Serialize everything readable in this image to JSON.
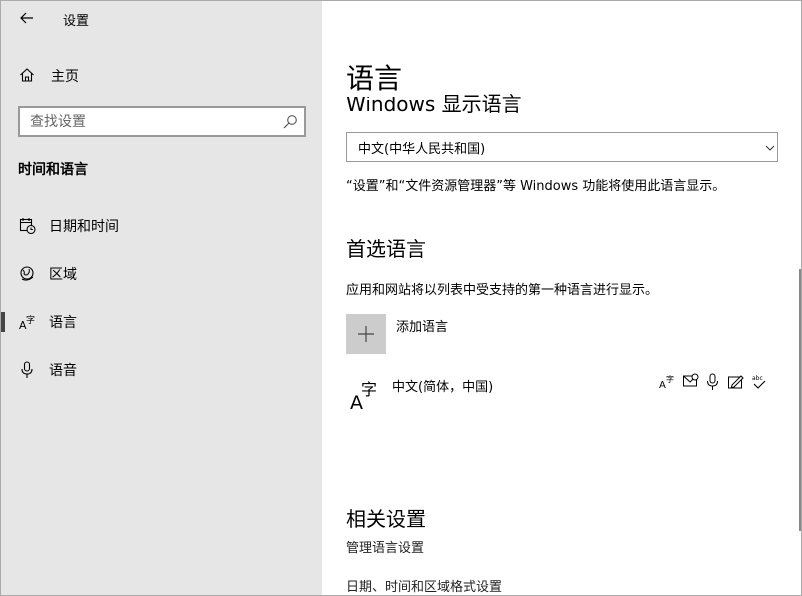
{
  "window": {
    "title": "设置",
    "minimize_label": "—",
    "maximize_label": "□",
    "close_label": "✕"
  },
  "sidebar": {
    "home_label": "主页",
    "search_placeholder": "查找设置",
    "section_title": "时间和语言",
    "items": [
      {
        "label": "日期和时间",
        "icon": "calendar-clock-icon"
      },
      {
        "label": "区域",
        "icon": "globe-region-icon"
      },
      {
        "label": "语言",
        "icon": "language-icon",
        "active": true
      },
      {
        "label": "语音",
        "icon": "microphone-icon"
      }
    ]
  },
  "main": {
    "title": "语言",
    "display_language_heading": "Windows 显示语言",
    "display_language_value": "中文(中华人民共和国)",
    "display_language_desc": "“设置”和“文件资源管理器”等 Windows 功能将使用此语言显示。",
    "preferred_heading": "首选语言",
    "preferred_desc": "应用和网站将以列表中受支持的第一种语言进行显示。",
    "add_language_label": "添加语言",
    "languages": [
      {
        "label": "中文(简体，中国)",
        "features": [
          "display-language-icon",
          "text-to-speech-icon",
          "speech-recognition-icon",
          "handwriting-icon",
          "spell-check-icon"
        ]
      }
    ],
    "related_heading": "相关设置",
    "related_links": [
      "管理语言设置",
      "日期、时间和区域格式设置"
    ]
  }
}
